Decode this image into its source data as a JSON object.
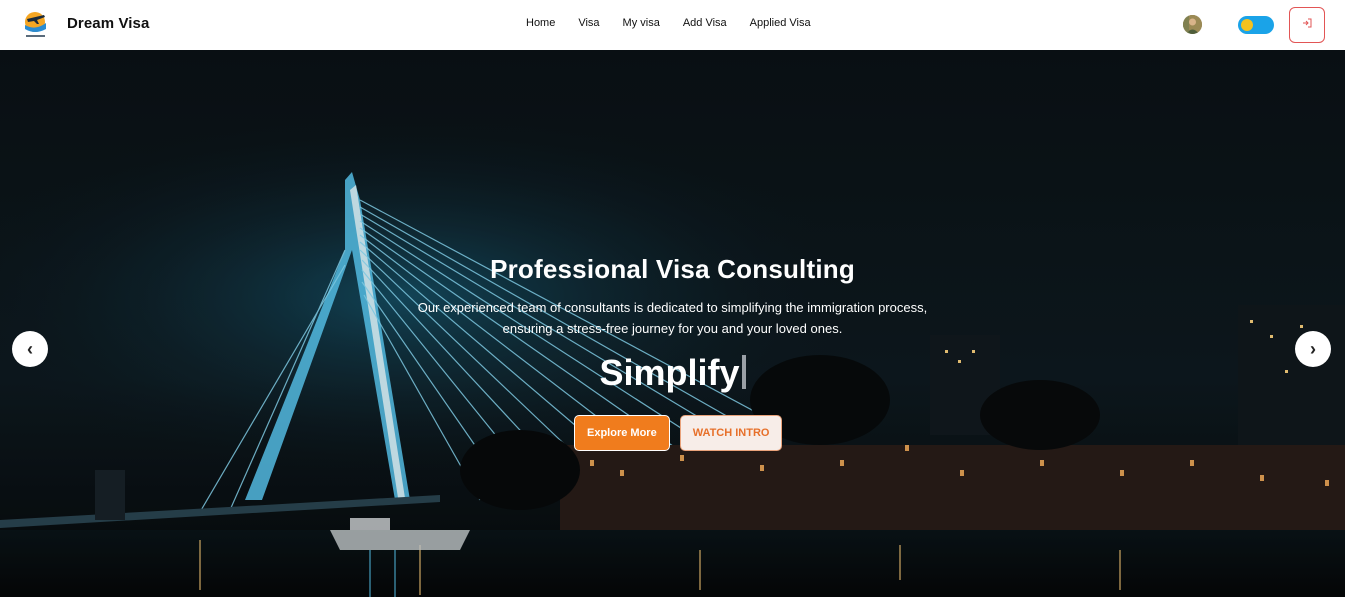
{
  "brand": {
    "name": "Dream Visa"
  },
  "nav": {
    "links": [
      "Home",
      "Visa",
      "My visa",
      "Add Visa",
      "Applied Visa"
    ]
  },
  "hero": {
    "title": "Professional Visa Consulting",
    "subtitle_line1": "Our experienced team of consultants is dedicated to simplifying the immigration process,",
    "subtitle_line2": "ensuring a stress-free journey for you and your loved ones.",
    "typed_word": "Simplify",
    "explore_label": "Explore More",
    "watch_label": "WATCH INTRO",
    "prev_arrow": "‹",
    "next_arrow": "›"
  },
  "colors": {
    "accent": "#f07c1d",
    "toggle": "#1aa3e8",
    "toggle_knob": "#f4c21f",
    "logout_border": "#e25555"
  },
  "icons": {
    "logo": "airplane-logo-icon",
    "avatar": "user-avatar",
    "theme_toggle": "theme-toggle",
    "logout": "logout-icon"
  }
}
